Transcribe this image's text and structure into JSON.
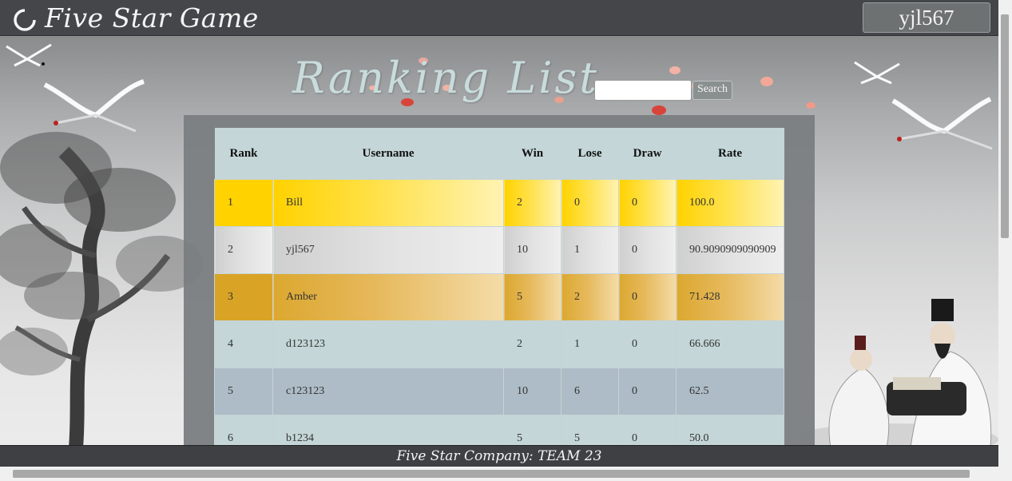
{
  "header": {
    "brand": "Five Star Game",
    "user_button": "yjl567"
  },
  "ranking": {
    "title": "Ranking List",
    "search_placeholder": "",
    "search_button": "Search",
    "columns": [
      "Rank",
      "Username",
      "Win",
      "Lose",
      "Draw",
      "Rate"
    ],
    "rows": [
      {
        "rank": "1",
        "username": "Bill",
        "win": "2",
        "lose": "0",
        "draw": "0",
        "rate": "100.0"
      },
      {
        "rank": "2",
        "username": "yjl567",
        "win": "10",
        "lose": "1",
        "draw": "0",
        "rate": "90.9090909090909"
      },
      {
        "rank": "3",
        "username": "Amber",
        "win": "5",
        "lose": "2",
        "draw": "0",
        "rate": "71.428"
      },
      {
        "rank": "4",
        "username": "d123123",
        "win": "2",
        "lose": "1",
        "draw": "0",
        "rate": "66.666"
      },
      {
        "rank": "5",
        "username": "c123123",
        "win": "10",
        "lose": "6",
        "draw": "0",
        "rate": "62.5"
      },
      {
        "rank": "6",
        "username": "b1234",
        "win": "5",
        "lose": "5",
        "draw": "0",
        "rate": "50.0"
      }
    ]
  },
  "footer": {
    "text": "Five Star Company: TEAM 23"
  },
  "colors": {
    "header_bg": "#44464a",
    "rank1_gold": "#ffd200",
    "rank2_silver": "#cfcfcf",
    "rank3_bronze": "#dca830",
    "row_teal": "#c4d6d7",
    "row_slate": "#adbcc6"
  },
  "decorations": [
    "cranes",
    "ink-tree",
    "petals",
    "chess-scholars"
  ]
}
